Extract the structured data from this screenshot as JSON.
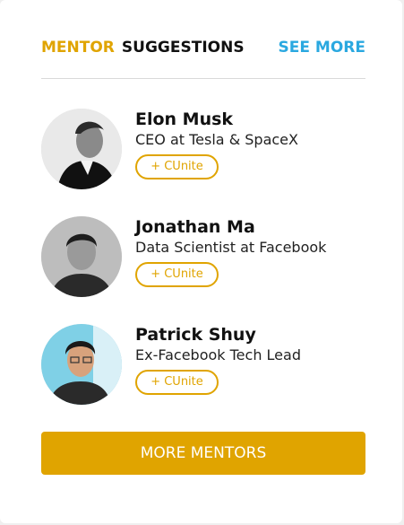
{
  "header": {
    "title_part1": "MENTOR",
    "title_part2": "SUGGESTIONS",
    "see_more": "SEE MORE"
  },
  "mentors": [
    {
      "name": "Elon Musk",
      "title": "CEO at Tesla & SpaceX",
      "action": "+ CUnite",
      "avatar": "person-photo-grayscale"
    },
    {
      "name": "Jonathan Ma",
      "title": "Data Scientist at Facebook",
      "action": "+ CUnite",
      "avatar": "person-photo-grayscale"
    },
    {
      "name": "Patrick Shuy",
      "title": "Ex-Facebook Tech Lead",
      "action": "+ CUnite",
      "avatar": "person-photo-color"
    }
  ],
  "footer": {
    "more_mentors": "MORE MENTORS"
  },
  "colors": {
    "accent": "#e0a400",
    "link": "#2aa8e0",
    "text": "#111111"
  }
}
